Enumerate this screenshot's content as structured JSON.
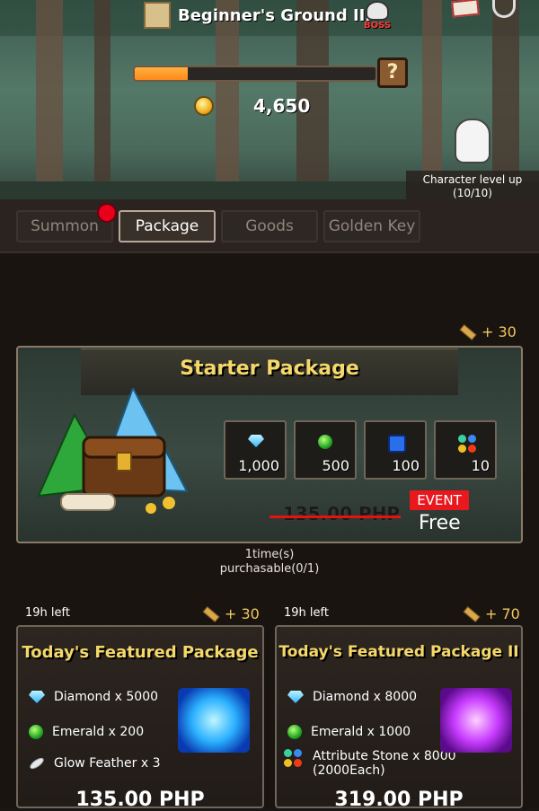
{
  "header": {
    "stage_title": "Beginner's Ground III",
    "boss_label": "BOSS",
    "gold": "4,650",
    "progress": 0.22,
    "mystery_symbol": "?",
    "level_up_text": "Character level up",
    "level_up_count": "(10/10)"
  },
  "tabs": [
    {
      "label": "Summon"
    },
    {
      "label": "Package"
    },
    {
      "label": "Goods"
    },
    {
      "label": "Golden Key"
    }
  ],
  "starter": {
    "key_reward": "+ 30",
    "title": "Starter Package",
    "items": [
      {
        "icon": "diamond-icon",
        "qty": "1,000"
      },
      {
        "icon": "emerald-icon",
        "qty": "500"
      },
      {
        "icon": "dice-icon",
        "qty": "100"
      },
      {
        "icon": "attribute-stone-icon",
        "qty": "10"
      }
    ],
    "old_price": "135.00 PHP",
    "event_badge": "EVENT",
    "price": "Free",
    "purchase_info_1": "1time(s)",
    "purchase_info_2": "purchasable(0/1)"
  },
  "featured": [
    {
      "time_left": "19h left",
      "key_reward": "+ 30",
      "title": "Today's Featured Package",
      "lines": [
        "Diamond x 5000",
        "Emerald x 200",
        "Glow Feather x 3"
      ],
      "price": "135.00 PHP"
    },
    {
      "time_left": "19h left",
      "key_reward": "+ 70",
      "title": "Today's Featured Package II",
      "lines": [
        "Diamond x 8000",
        "Emerald x 1000",
        "Attribute Stone x 8000",
        "(2000Each)"
      ],
      "price": "319.00 PHP"
    }
  ],
  "colors": {
    "accent_gold": "#f5d86a",
    "event_red": "#e8181e",
    "progress_orange": "#ff8a1a"
  }
}
